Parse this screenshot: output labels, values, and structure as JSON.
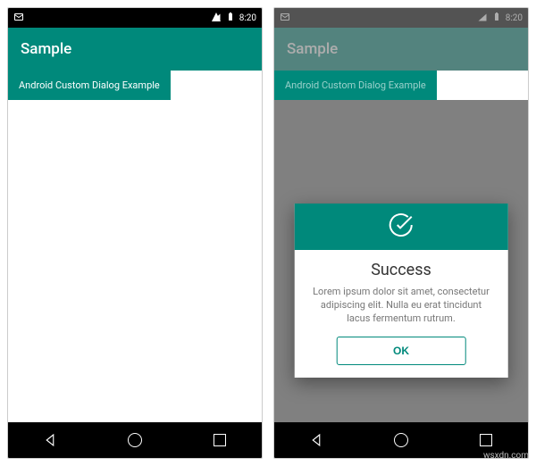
{
  "status": {
    "time": "8:20"
  },
  "app": {
    "title": "Sample"
  },
  "tab": {
    "label": "Android Custom Dialog Example"
  },
  "dialog": {
    "title": "Success",
    "message": "Lorem ipsum dolor sit amet, consectetur adipiscing elit. Nulla eu erat tincidunt lacus fermentum rutrum.",
    "ok": "OK"
  },
  "watermark": "wsxdn.com"
}
